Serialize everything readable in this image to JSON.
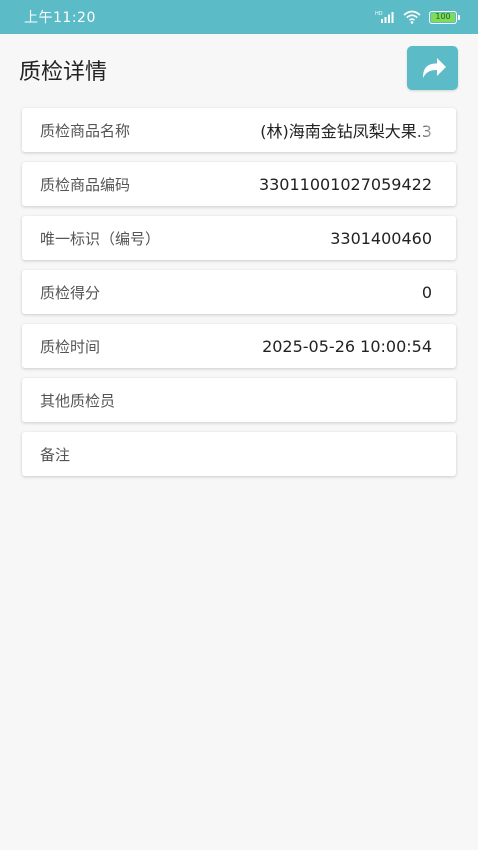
{
  "status_bar": {
    "time": "上午11:20",
    "battery_level": "100",
    "hd_label": "HD",
    "icons": [
      "hd-signal-icon",
      "wifi-icon",
      "battery-icon"
    ]
  },
  "header": {
    "title": "质检详情",
    "share_icon": "share-arrow-icon"
  },
  "colors": {
    "accent": "#5bbcc7",
    "background": "#f7f7f7",
    "card": "#ffffff",
    "battery_fill": "#7ddc5a"
  },
  "details": {
    "product_name": {
      "label": "质检商品名称",
      "value": "(林)海南金钻凤梨大果.3"
    },
    "product_code": {
      "label": "质检商品编码",
      "value": "33011001027059422"
    },
    "unique_id": {
      "label": "唯一标识（编号）",
      "value": "3301400460"
    },
    "score": {
      "label": "质检得分",
      "value": "0"
    },
    "inspection_time": {
      "label": "质检时间",
      "value": "2025-05-26 10:00:54"
    },
    "other_inspectors": {
      "label": "其他质检员",
      "value": ""
    },
    "remarks": {
      "label": "备注",
      "value": ""
    }
  }
}
